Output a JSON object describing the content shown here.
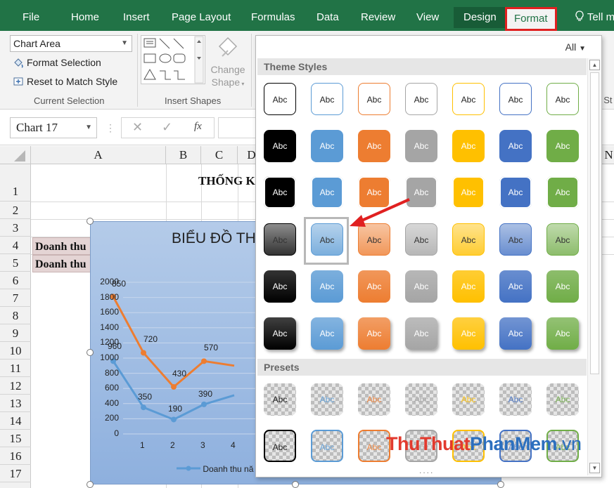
{
  "ribbon_tabs": {
    "file": "File",
    "home": "Home",
    "insert": "Insert",
    "page_layout": "Page Layout",
    "formulas": "Formulas",
    "data": "Data",
    "review": "Review",
    "view": "View",
    "design": "Design",
    "format": "Format",
    "tell_me": "Tell m"
  },
  "current_selection": {
    "dropdown_value": "Chart Area",
    "format_selection": "Format Selection",
    "reset_style": "Reset to Match Style",
    "group_label": "Current Selection"
  },
  "insert_shapes": {
    "change_shape": "Change",
    "change_shape_2": "Shape",
    "group_label": "Insert Shapes"
  },
  "ribbon_fragment": "t St",
  "formula_bar": {
    "name_box": "Chart 17",
    "fx": "fx"
  },
  "sheet": {
    "columns": [
      "A",
      "B",
      "C",
      "D",
      "N"
    ],
    "rows": [
      "1",
      "2",
      "3",
      "4",
      "5",
      "6",
      "7",
      "8",
      "9",
      "10",
      "11",
      "12",
      "13",
      "14",
      "15",
      "16",
      "17"
    ],
    "title": "THỐNG K",
    "row4_label": "Doanh thu",
    "row5_label": "Doanh thu"
  },
  "chart": {
    "title": "BIỂU ĐỒ TH",
    "legend_text": "Doanh thu nă",
    "y_ticks": [
      "2000",
      "1800",
      "1600",
      "1400",
      "1200",
      "1000",
      "800",
      "600",
      "400",
      "200",
      "0"
    ],
    "x_ticks": [
      "1",
      "2",
      "3",
      "4"
    ],
    "series_orange_labels": [
      "850",
      "720",
      "430",
      "570"
    ],
    "series_blue_labels": [
      "960",
      "350",
      "190",
      "390"
    ],
    "colors": {
      "orange": "#ed7d31",
      "blue": "#5b9bd5",
      "chart_bg": "#a3bfe6"
    }
  },
  "chart_data": {
    "type": "line",
    "title": "BIỂU ĐỒ TH",
    "x": [
      1,
      2,
      3,
      4
    ],
    "ylim": [
      0,
      2000
    ],
    "series": [
      {
        "name": "Doanh thu nă",
        "color": "#5b9bd5",
        "values": [
          960,
          350,
          190,
          390
        ]
      },
      {
        "color": "#ed7d31",
        "values": [
          1810,
          1070,
          620,
          960
        ]
      }
    ],
    "data_labels": {
      "orange": [
        "850",
        "720",
        "430",
        "570"
      ],
      "blue": [
        "960",
        "350",
        "190",
        "390"
      ]
    },
    "grid": true,
    "legend": "bottom"
  },
  "gallery": {
    "filter": "All",
    "theme_header": "Theme Styles",
    "presets_header": "Presets",
    "style_label": "Abc",
    "more_indicator": "....",
    "theme_colors": [
      "#000000",
      "#5b9bd5",
      "#ed7d31",
      "#a5a5a5",
      "#ffc000",
      "#4472c4",
      "#70ad47"
    ],
    "watermark": {
      "part1": "ThuThuat",
      "part2": "PhanMem",
      "part3": ".vn"
    }
  }
}
